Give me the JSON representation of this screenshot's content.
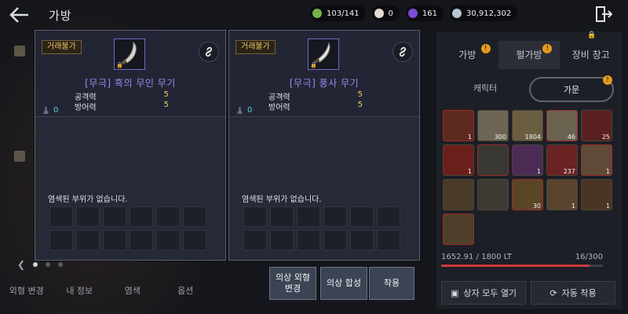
{
  "screen": {
    "title": "가방",
    "back_icon": "back-arrow-icon",
    "exit_icon": "exit-door-icon"
  },
  "resources": [
    {
      "icon": "potion-icon",
      "value": "103/141",
      "color": "#76b24a"
    },
    {
      "icon": "pearl-icon",
      "value": "0",
      "color": "#e6d9d2"
    },
    {
      "icon": "purple-orb-icon",
      "value": "161",
      "color": "#7d4bd6"
    },
    {
      "icon": "silver-coin-icon",
      "value": "30,912,302",
      "color": "#b9c4d1"
    }
  ],
  "cards": [
    {
      "trade_label": "거래불가",
      "item_name": "[무극] 흑의 무인 무기",
      "stats": [
        {
          "label": "공격력",
          "value": "5"
        },
        {
          "label": "방어력",
          "value": "5"
        }
      ],
      "durability": "0",
      "dye_note": "염색된 부위가 없습니다."
    },
    {
      "trade_label": "거래불가",
      "item_name": "[무극] 풍사 무기",
      "stats": [
        {
          "label": "공격력",
          "value": "5"
        },
        {
          "label": "방어력",
          "value": "5"
        }
      ],
      "durability": "0",
      "dye_note": "염색된 부위가 없습니다."
    }
  ],
  "actions": {
    "appearance_change_line1": "의상 외형",
    "appearance_change_line2": "변경",
    "synthesis": "의상 합성",
    "equip": "착용"
  },
  "left_tabs": [
    "외형 변경",
    "내 정보",
    "염색",
    "옵션"
  ],
  "right_panel": {
    "tabs": [
      "가방",
      "펄가방",
      "장비 창고"
    ],
    "segments": [
      "캐릭터",
      "가문"
    ],
    "grid_items": [
      {
        "qty": "1",
        "color": "#5c2a1e"
      },
      {
        "qty": "300",
        "color": "#6e6654"
      },
      {
        "qty": "1804",
        "color": "#6a5d40"
      },
      {
        "qty": "46",
        "color": "#6b6250"
      },
      {
        "qty": "25",
        "color": "#5a2020"
      },
      {
        "qty": "1",
        "color": "#6b1f1a"
      },
      {
        "qty": "",
        "color": "#3a3832"
      },
      {
        "qty": "1",
        "color": "#4c2c55"
      },
      {
        "qty": "237",
        "color": "#6a2222"
      },
      {
        "qty": "1",
        "color": "#5e4a36"
      },
      {
        "qty": "",
        "color": "#4a3a28"
      },
      {
        "qty": "",
        "color": "#3d3a33"
      },
      {
        "qty": "30",
        "color": "#5a4526"
      },
      {
        "qty": "1",
        "color": "#5a4430"
      },
      {
        "qty": "1",
        "color": "#4a3524"
      },
      {
        "qty": "",
        "color": "#4e3e2a"
      }
    ],
    "weight": "1652.91 / 1800 LT",
    "weight_fraction": 0.918,
    "slots": "16/300",
    "open_all_label": "상자 모두 열기",
    "auto_equip_label": "자동 착용"
  },
  "colors": {
    "accent_orange": "#e39a1e",
    "item_name_purple": "#9b8af0",
    "stat_value_gold": "#f2c861",
    "trade_gold": "#f0c061",
    "durability_cyan": "#5fd0dc"
  }
}
